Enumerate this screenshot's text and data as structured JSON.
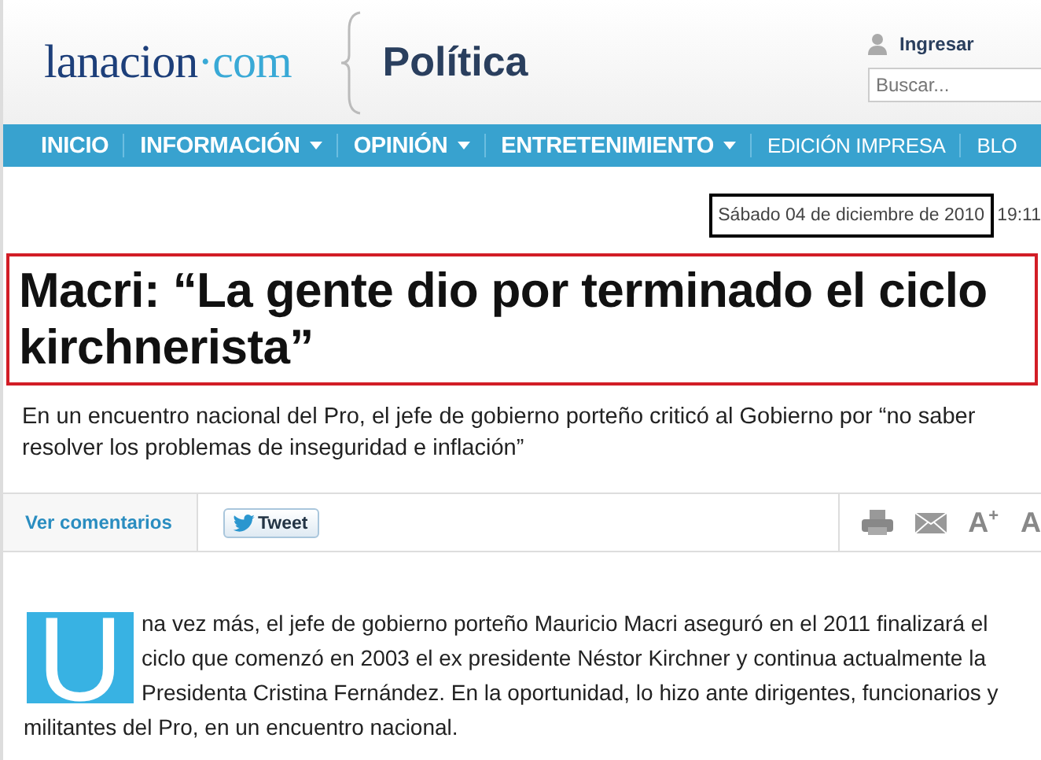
{
  "header": {
    "logo": {
      "part1": "lanacion",
      "dot": "·",
      "part2": "com"
    },
    "section": "Política",
    "login": "Ingresar",
    "search": {
      "placeholder": "Buscar..."
    }
  },
  "nav": [
    {
      "label": "INICIO",
      "dropdown": false,
      "bold": true
    },
    {
      "label": "INFORMACIÓN",
      "dropdown": true,
      "bold": true
    },
    {
      "label": "OPINIÓN",
      "dropdown": true,
      "bold": true
    },
    {
      "label": "ENTRETENIMIENTO",
      "dropdown": true,
      "bold": true
    },
    {
      "label": "EDICIÓN IMPRESA",
      "dropdown": false,
      "bold": false
    },
    {
      "label": "BLO",
      "dropdown": false,
      "bold": false
    }
  ],
  "article": {
    "date": "Sábado 04 de diciembre de 2010",
    "time": "19:11",
    "headline": "Macri: “La gente dio por terminado el ciclo kirchnerista”",
    "subtitle": "En un encuentro nacional del Pro, el jefe de gobierno porteño criticó al Gobierno por “no saber resolver los problemas de inseguridad e inflación”",
    "toolbar": {
      "comments": "Ver comentarios",
      "tweet": "Tweet",
      "font_larger": "A$^{+}$",
      "font_smaller": "A"
    },
    "drop_cap": "U",
    "body": "na vez más, el jefe de gobierno porteño Mauricio Macri aseguró en el 2011 finalizará el ciclo que comenzó en 2003 el ex presidente Néstor Kirchner y continua actualmente la Presidenta Cristina Fernández. En la oportunidad, lo hizo ante dirigentes, funcionarios y militantes del Pro, en un encuentro nacional."
  }
}
